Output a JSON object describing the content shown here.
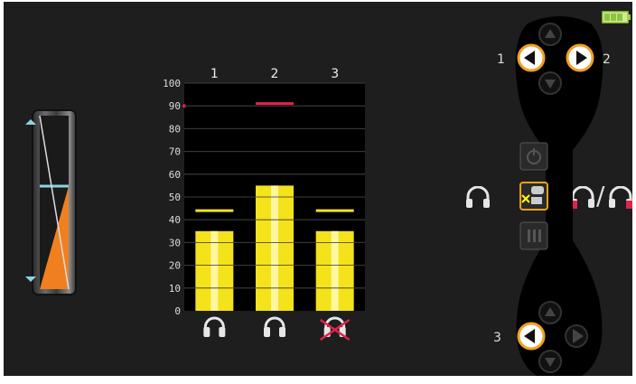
{
  "battery": {
    "icon": "battery-full-icon",
    "color": "#a6e23a"
  },
  "level_slider": {
    "up_icon": "arrow-up-icon",
    "down_icon": "arrow-down-icon",
    "fill_level_pct": 58,
    "accent": "#f07f20",
    "marker_color": "#8ad4e0"
  },
  "chart_data": {
    "type": "bar",
    "categories": [
      "1",
      "2",
      "3"
    ],
    "values": [
      35,
      55,
      35
    ],
    "markers_yellow": [
      44,
      null,
      44
    ],
    "markers_red": [
      null,
      91,
      null
    ],
    "y_ticks": [
      "0",
      "10",
      "20",
      "30",
      "40",
      "50",
      "60",
      "70",
      "80",
      "90",
      "100"
    ],
    "ylim": [
      0,
      100
    ],
    "grid": true,
    "bar_color": "#f4e21a",
    "marker_yellow_color": "#f4e21a",
    "marker_red_color": "#e0234a"
  },
  "chart_footer_icons": [
    {
      "name": "headphones-icon-1",
      "crossed": false
    },
    {
      "name": "headphones-icon-2",
      "crossed": false
    },
    {
      "name": "headphones-icon-3",
      "crossed": true
    }
  ],
  "right_panel": {
    "label_1": "1",
    "label_2": "2",
    "label_3": "3",
    "accent": "#f0a020",
    "icons": {
      "power": "power-icon",
      "selftest": "tool-speech-icon",
      "menu": "menu-icon"
    }
  },
  "side_icons": {
    "left": "headphones-icon",
    "slash": "/"
  }
}
